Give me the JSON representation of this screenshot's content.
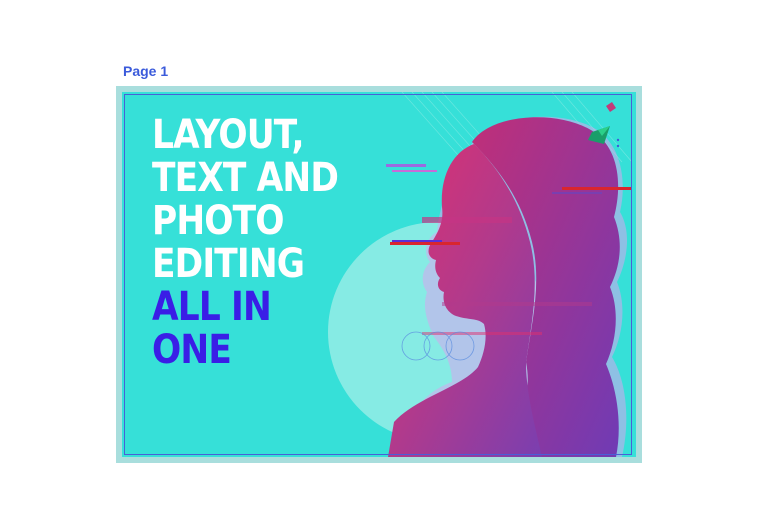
{
  "page": {
    "label": "Page 1"
  },
  "poster": {
    "headline_white": [
      "LAYOUT,",
      "TEXT AND",
      "PHOTO",
      "EDITING"
    ],
    "headline_blue": [
      "ALL IN",
      "ONE"
    ]
  },
  "colors": {
    "page_label": "#3b5bdb",
    "background": "#36e0d8",
    "frame": "#a9dedd",
    "guide": "#4a5fd6",
    "headline_white": "#ffffff",
    "headline_blue": "#3a1ee6",
    "portrait": "#b53a8a"
  },
  "icons": {
    "portrait": "glitch-portrait-illustration"
  }
}
